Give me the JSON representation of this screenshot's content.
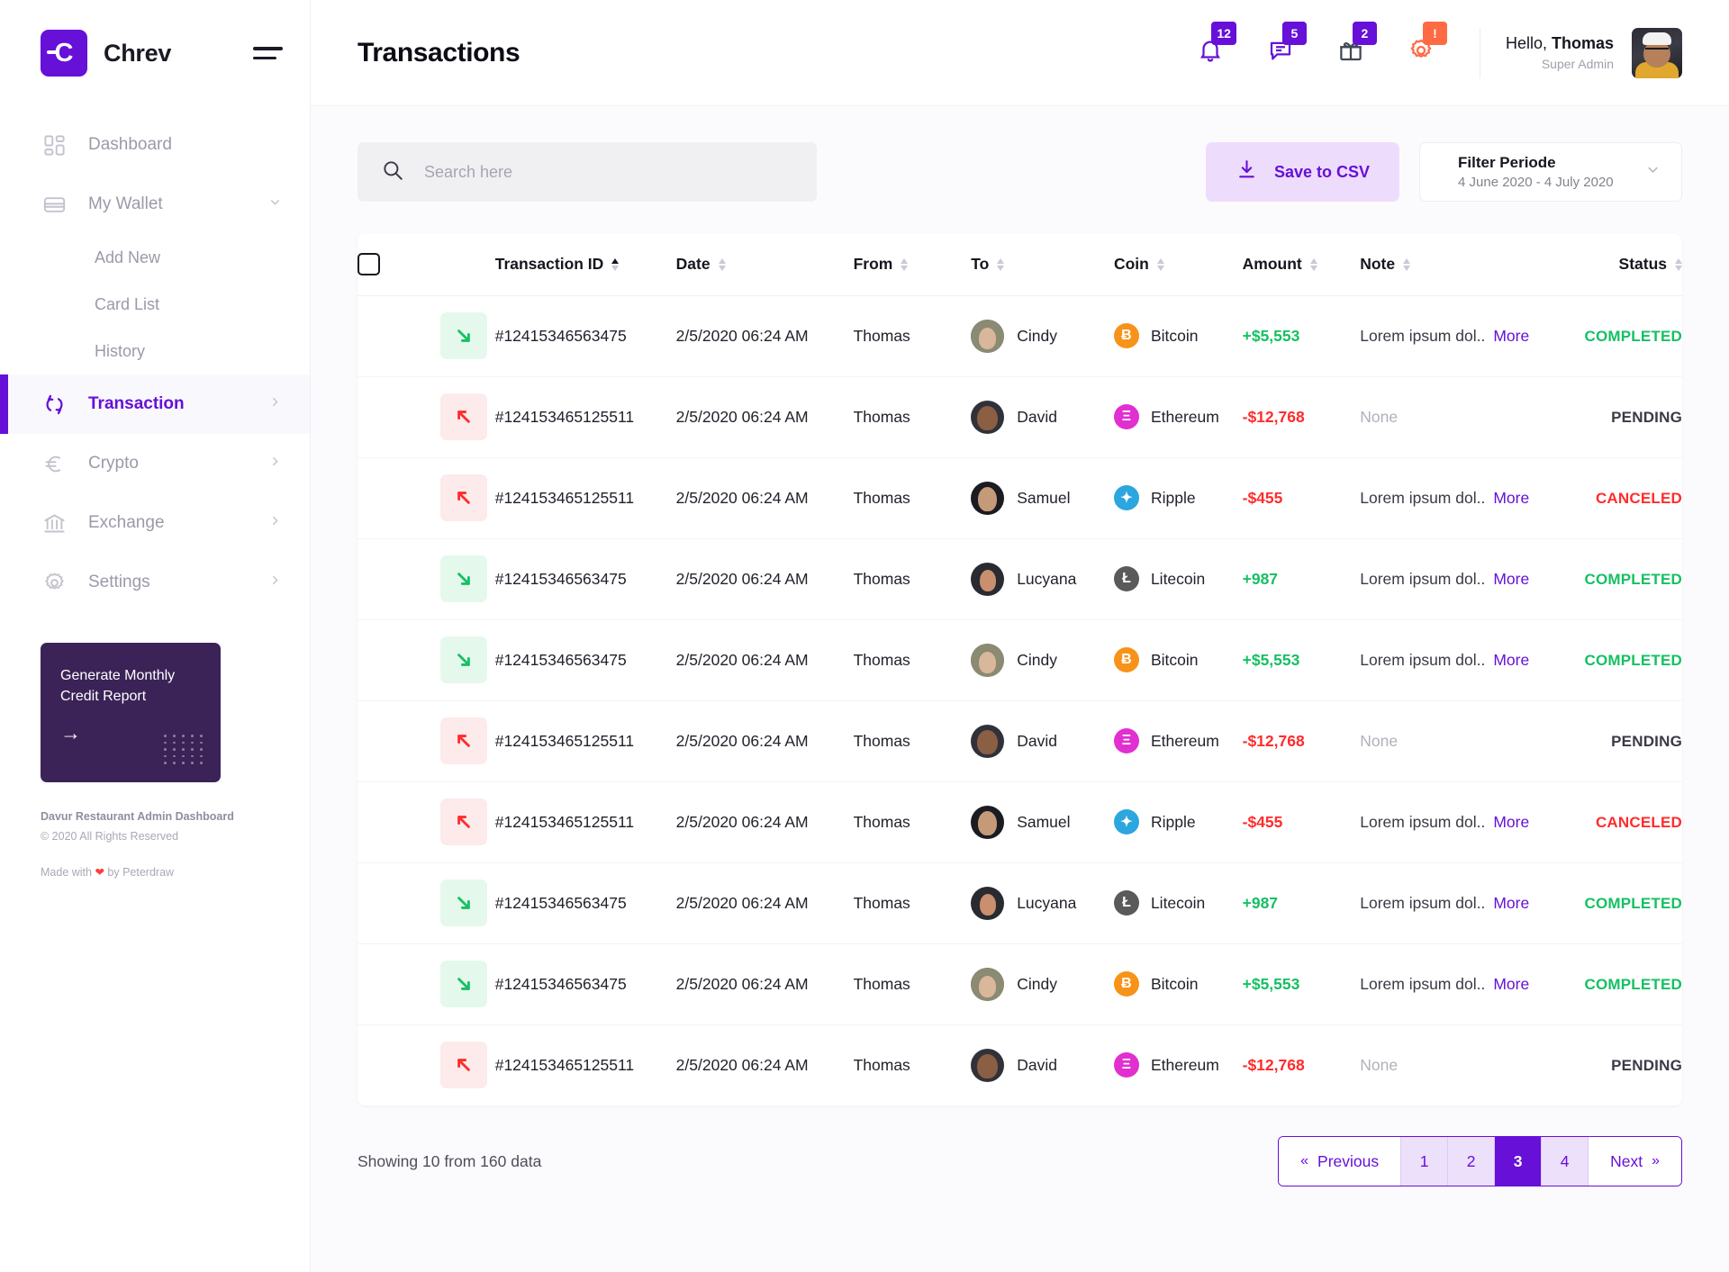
{
  "brand": {
    "name": "Chrev",
    "logo_glyph": "C"
  },
  "sidebar": {
    "items": [
      {
        "label": "Dashboard",
        "icon": "dashboard-icon"
      },
      {
        "label": "My Wallet",
        "icon": "wallet-icon"
      },
      {
        "label": "Transaction",
        "icon": "transaction-icon"
      },
      {
        "label": "Crypto",
        "icon": "crypto-icon"
      },
      {
        "label": "Exchange",
        "icon": "exchange-icon"
      },
      {
        "label": "Settings",
        "icon": "settings-icon"
      }
    ],
    "wallet_children": [
      "Add New",
      "Card List",
      "History"
    ],
    "promo": {
      "title": "Generate Monthly Credit Report",
      "arrow": "→"
    },
    "footer": {
      "line1": "Davur Restaurant Admin Dashboard",
      "line2": "© 2020 All Rights Reserved",
      "made_prefix": "Made with ",
      "made_heart": "❤",
      "made_suffix": " by Peterdraw"
    }
  },
  "header": {
    "title": "Transactions",
    "icons": [
      {
        "name": "bell-icon",
        "badge": "12",
        "badge_type": "count"
      },
      {
        "name": "chat-icon",
        "badge": "5",
        "badge_type": "count"
      },
      {
        "name": "gift-icon",
        "badge": "2",
        "badge_type": "count"
      },
      {
        "name": "gear-icon",
        "badge": "!",
        "badge_type": "warn"
      }
    ],
    "user": {
      "greeting": "Hello, ",
      "name": "Thomas",
      "role": "Super Admin"
    }
  },
  "toolbar": {
    "search_placeholder": "Search here",
    "search_value": "",
    "csv_label": "Save to CSV",
    "filter_title": "Filter Periode",
    "filter_range": "4 June 2020 - 4 July 2020"
  },
  "table": {
    "columns": [
      "Transaction ID",
      "Date",
      "From",
      "To",
      "Coin",
      "Amount",
      "Note",
      "Status"
    ],
    "sorted_column": "Transaction ID",
    "rows": [
      {
        "direction": "in",
        "id": "#12415346563475",
        "date": "2/5/2020 06:24 AM",
        "from": "Thomas",
        "to": "Cindy",
        "avatar": "cindy",
        "coin": "Bitcoin",
        "coin_symbol": "Ƀ",
        "coin_color": "#F7931A",
        "amount": "+$5,553",
        "amount_sign": "pos",
        "note": "Lorem ipsum dol..",
        "note_more": "More",
        "status": "COMPLETED"
      },
      {
        "direction": "out",
        "id": "#124153465125511",
        "date": "2/5/2020 06:24 AM",
        "from": "Thomas",
        "to": "David",
        "avatar": "david",
        "coin": "Ethereum",
        "coin_symbol": "Ξ",
        "coin_color": "#E12FD0",
        "amount": "-$12,768",
        "amount_sign": "neg",
        "note": "None",
        "note_more": "",
        "status": "PENDING"
      },
      {
        "direction": "out",
        "id": "#124153465125511",
        "date": "2/5/2020 06:24 AM",
        "from": "Thomas",
        "to": "Samuel",
        "avatar": "samuel",
        "coin": "Ripple",
        "coin_symbol": "✦",
        "coin_color": "#2BA6DE",
        "amount": "-$455",
        "amount_sign": "neg",
        "note": "Lorem ipsum dol..",
        "note_more": "More",
        "status": "CANCELED"
      },
      {
        "direction": "in",
        "id": "#12415346563475",
        "date": "2/5/2020 06:24 AM",
        "from": "Thomas",
        "to": "Lucyana",
        "avatar": "lucyana",
        "coin": "Litecoin",
        "coin_symbol": "Ł",
        "coin_color": "#5A5A5A",
        "amount": "+987",
        "amount_sign": "pos",
        "note": "Lorem ipsum dol..",
        "note_more": "More",
        "status": "COMPLETED"
      },
      {
        "direction": "in",
        "id": "#12415346563475",
        "date": "2/5/2020 06:24 AM",
        "from": "Thomas",
        "to": "Cindy",
        "avatar": "cindy",
        "coin": "Bitcoin",
        "coin_symbol": "Ƀ",
        "coin_color": "#F7931A",
        "amount": "+$5,553",
        "amount_sign": "pos",
        "note": "Lorem ipsum dol..",
        "note_more": "More",
        "status": "COMPLETED"
      },
      {
        "direction": "out",
        "id": "#124153465125511",
        "date": "2/5/2020 06:24 AM",
        "from": "Thomas",
        "to": "David",
        "avatar": "david",
        "coin": "Ethereum",
        "coin_symbol": "Ξ",
        "coin_color": "#E12FD0",
        "amount": "-$12,768",
        "amount_sign": "neg",
        "note": "None",
        "note_more": "",
        "status": "PENDING"
      },
      {
        "direction": "out",
        "id": "#124153465125511",
        "date": "2/5/2020 06:24 AM",
        "from": "Thomas",
        "to": "Samuel",
        "avatar": "samuel",
        "coin": "Ripple",
        "coin_symbol": "✦",
        "coin_color": "#2BA6DE",
        "amount": "-$455",
        "amount_sign": "neg",
        "note": "Lorem ipsum dol..",
        "note_more": "More",
        "status": "CANCELED"
      },
      {
        "direction": "in",
        "id": "#12415346563475",
        "date": "2/5/2020 06:24 AM",
        "from": "Thomas",
        "to": "Lucyana",
        "avatar": "lucyana",
        "coin": "Litecoin",
        "coin_symbol": "Ł",
        "coin_color": "#5A5A5A",
        "amount": "+987",
        "amount_sign": "pos",
        "note": "Lorem ipsum dol..",
        "note_more": "More",
        "status": "COMPLETED"
      },
      {
        "direction": "in",
        "id": "#12415346563475",
        "date": "2/5/2020 06:24 AM",
        "from": "Thomas",
        "to": "Cindy",
        "avatar": "cindy",
        "coin": "Bitcoin",
        "coin_symbol": "Ƀ",
        "coin_color": "#F7931A",
        "amount": "+$5,553",
        "amount_sign": "pos",
        "note": "Lorem ipsum dol..",
        "note_more": "More",
        "status": "COMPLETED"
      },
      {
        "direction": "out",
        "id": "#124153465125511",
        "date": "2/5/2020 06:24 AM",
        "from": "Thomas",
        "to": "David",
        "avatar": "david",
        "coin": "Ethereum",
        "coin_symbol": "Ξ",
        "coin_color": "#E12FD0",
        "amount": "-$12,768",
        "amount_sign": "neg",
        "note": "None",
        "note_more": "",
        "status": "PENDING"
      }
    ]
  },
  "pagination": {
    "showing": "Showing 10 from 160 data",
    "previous": "Previous",
    "next": "Next",
    "pages": [
      "1",
      "2",
      "3",
      "4"
    ],
    "active_page": "3"
  },
  "colors": {
    "accent": "#6610D8",
    "accent_soft": "#eedcfd",
    "positive": "#16c063",
    "negative": "#ff2c2c",
    "warn": "#ff6a43",
    "promo_bg": "#3b2357"
  }
}
